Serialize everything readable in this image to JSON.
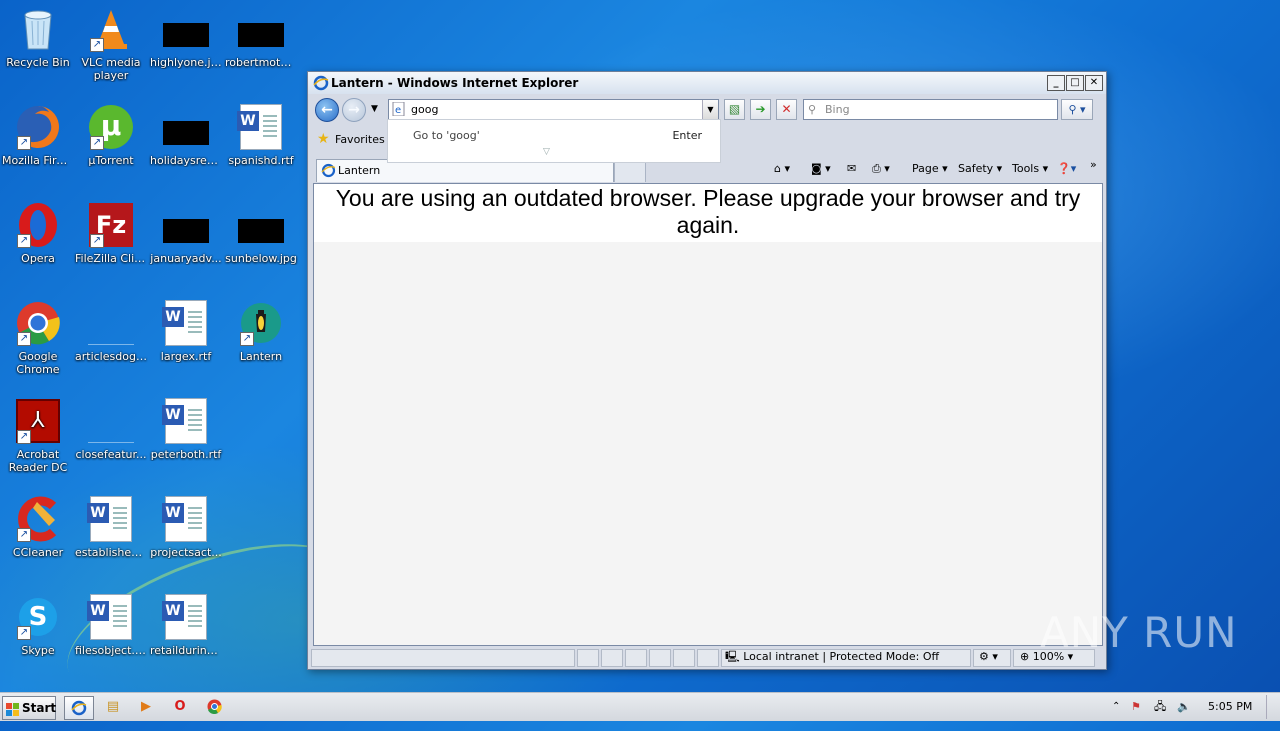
{
  "desktop": {
    "icons": [
      {
        "label": "Recycle Bin"
      },
      {
        "label": "VLC media player"
      },
      {
        "label": "highlyone.jpg"
      },
      {
        "label": "robertmotor..."
      },
      {
        "label": "Mozilla Firefox"
      },
      {
        "label": "µTorrent"
      },
      {
        "label": "holidaysrep..."
      },
      {
        "label": "spanishd.rtf"
      },
      {
        "label": "Opera"
      },
      {
        "label": "FileZilla Client"
      },
      {
        "label": "januaryadv..."
      },
      {
        "label": "sunbelow.jpg"
      },
      {
        "label": "Google Chrome"
      },
      {
        "label": "articlesdog...."
      },
      {
        "label": "largex.rtf"
      },
      {
        "label": "Lantern"
      },
      {
        "label": "Acrobat Reader DC"
      },
      {
        "label": "closefeatur..."
      },
      {
        "label": "peterboth.rtf"
      },
      {
        "label": "CCleaner"
      },
      {
        "label": "established..."
      },
      {
        "label": "projectsact..."
      },
      {
        "label": "Skype"
      },
      {
        "label": "filesobject.rtf"
      },
      {
        "label": "retailduring.rtf"
      }
    ]
  },
  "window": {
    "title": "Lantern - Windows Internet Explorer",
    "address_value": "goog",
    "search_placeholder": "Bing",
    "suggestion": {
      "go_to": "Go to 'goog'",
      "enter": "Enter"
    },
    "favorites_label": "Favorites",
    "tab_label": "Lantern",
    "command_bar": {
      "page": "Page",
      "safety": "Safety",
      "tools": "Tools"
    },
    "notice": "You are using an outdated browser. Please upgrade your browser and try again.",
    "status": {
      "zone": "Local intranet | Protected Mode: Off",
      "zoom": "100%"
    }
  },
  "taskbar": {
    "start_label": "Start",
    "clock": "5:05 PM"
  },
  "watermark": "ANY RUN",
  "colors": {
    "desktop_blue": "#0a63c9",
    "taskbar": "#d4d8de",
    "ie_frame": "#d6dbe6"
  }
}
